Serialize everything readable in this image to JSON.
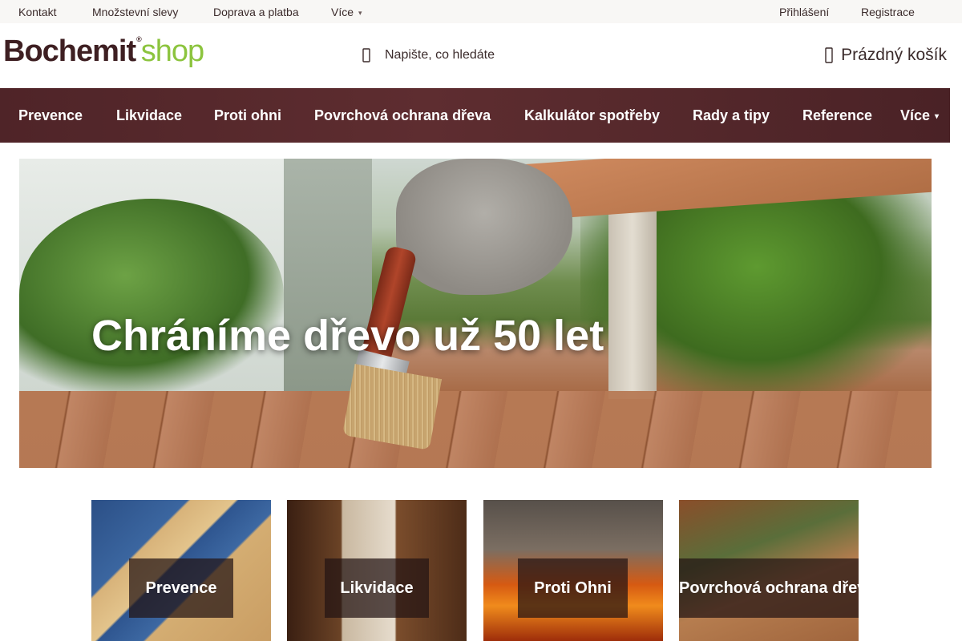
{
  "topbar": {
    "links": [
      "Kontakt",
      "Množstevní slevy",
      "Doprava a platba",
      "Více"
    ],
    "login": "Přihlášení",
    "register": "Registrace"
  },
  "header": {
    "logo_main": "Bochemit",
    "logo_suffix": "shop",
    "search_placeholder": "Napište, co hledáte",
    "cart_label": "Prázdný košík"
  },
  "nav": {
    "items": [
      "Prevence",
      "Likvidace",
      "Proti ohni",
      "Povrchová ochrana dřeva",
      "Kalkulátor spotřeby",
      "Rady a tipy",
      "Reference",
      "Více"
    ]
  },
  "hero": {
    "title": "Chráníme dřevo už 50 let"
  },
  "tiles": [
    "Prevence",
    "Likvidace",
    "Proti Ohni",
    "Povrchová ochrana dřeva"
  ],
  "colors": {
    "brand_dark": "#3e1f22",
    "brand_green": "#8cc43e",
    "nav_bg": "#552a2d"
  },
  "icons": {
    "search": "search-icon",
    "cart": "cart-icon",
    "caret": "chevron-down-icon"
  }
}
